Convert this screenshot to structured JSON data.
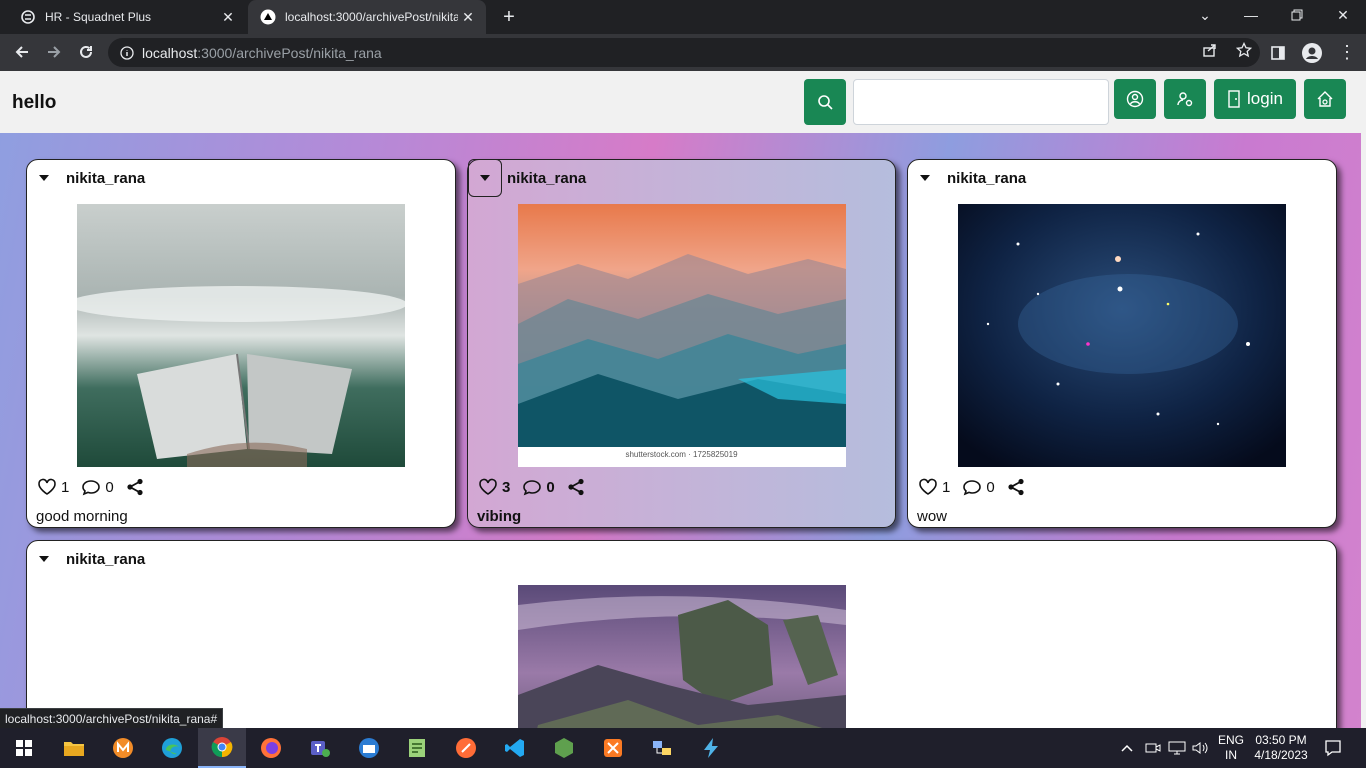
{
  "browser": {
    "tabs": [
      {
        "title": "HR - Squadnet Plus",
        "icon": "squadnet-favicon"
      },
      {
        "title": "localhost:3000/archivePost/nikita_rana",
        "icon": "nextjs-favicon"
      }
    ],
    "url_host": "localhost",
    "url_rest": ":3000/archivePost/nikita_rana",
    "status_link": "localhost:3000/archivePost/nikita_rana#"
  },
  "app": {
    "brand": "hello",
    "search_value": "",
    "login_label": "login",
    "accent": "#198754"
  },
  "posts": [
    {
      "username": "nikita_rana",
      "likes": "1",
      "comments": "0",
      "caption": "good morning",
      "image": "open-book-over-misty-valley"
    },
    {
      "username": "nikita_rana",
      "likes": "3",
      "comments": "0",
      "caption": "vibing",
      "image": "layered-mountains-sunset",
      "watermark": "shutterstock.com · 1725825019"
    },
    {
      "username": "nikita_rana",
      "likes": "1",
      "comments": "0",
      "caption": "wow",
      "image": "starry-galaxy"
    },
    {
      "username": "nikita_rana",
      "likes": "",
      "comments": "",
      "caption": "",
      "image": "purple-rock-landscape"
    }
  ],
  "taskbar": {
    "lang1": "ENG",
    "lang2": "IN",
    "time": "03:50 PM",
    "date": "4/18/2023"
  }
}
